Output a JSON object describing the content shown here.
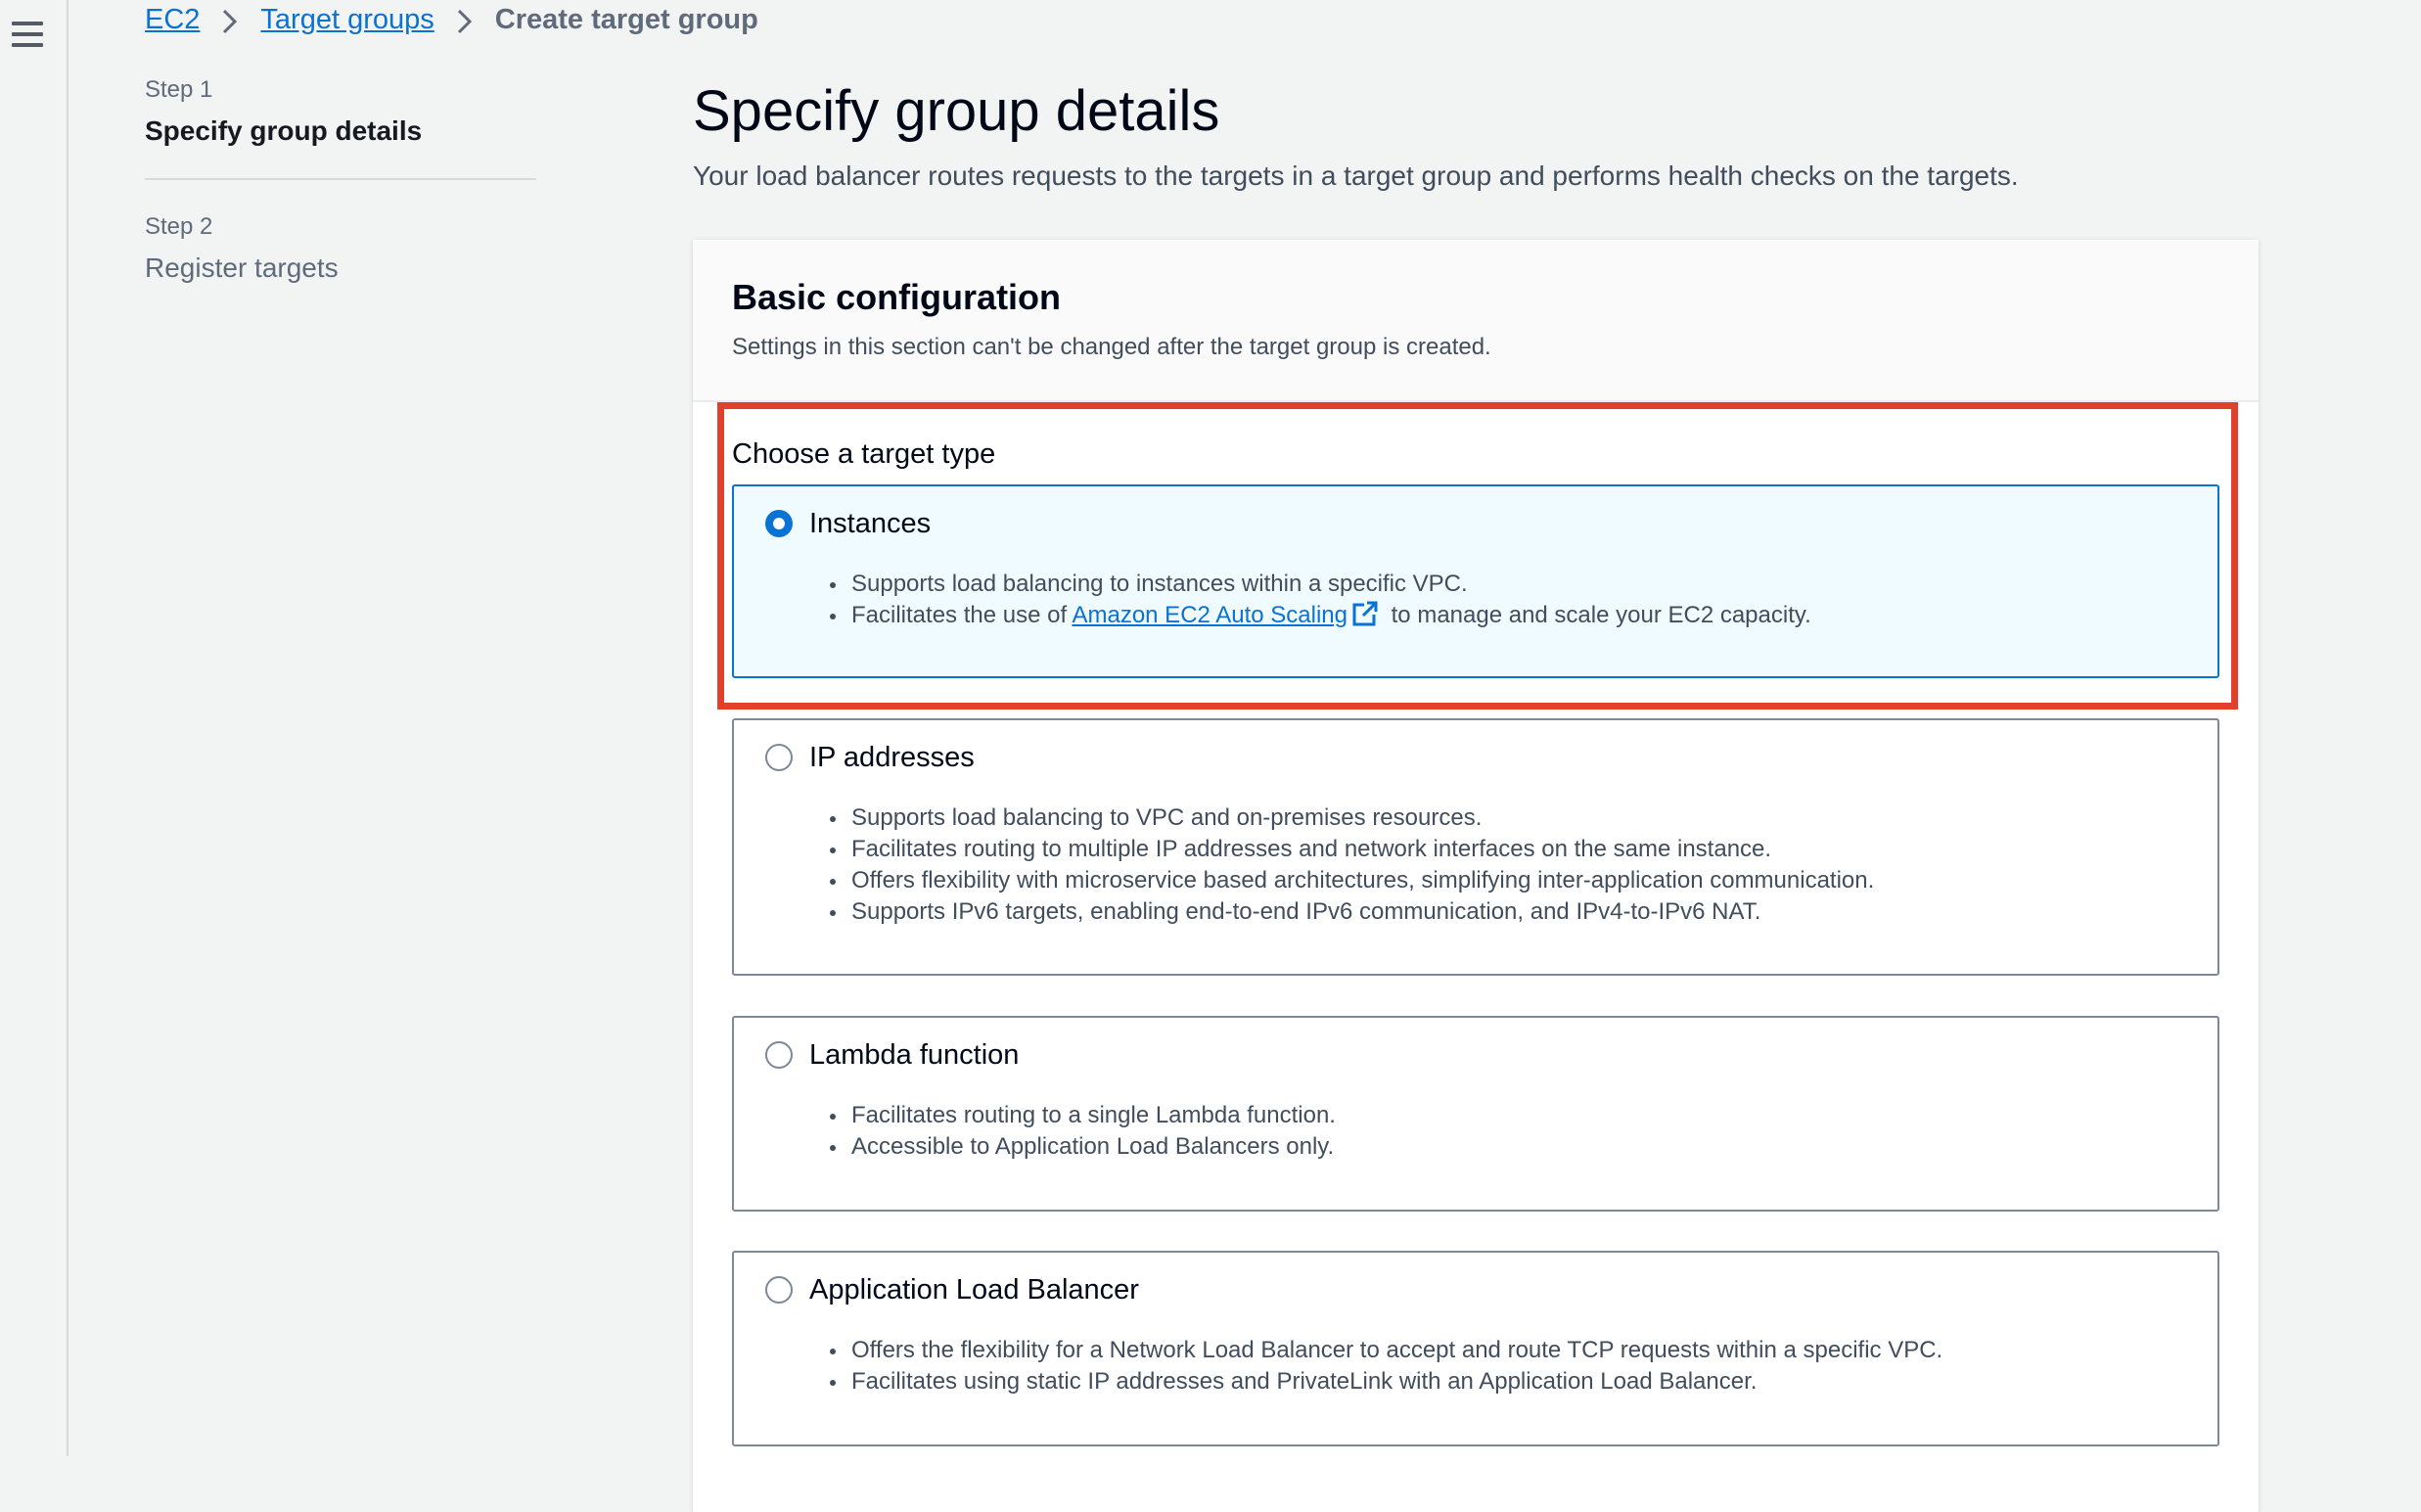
{
  "breadcrumb": {
    "items": [
      "EC2",
      "Target groups"
    ],
    "current": "Create target group"
  },
  "steps": [
    {
      "label": "Step 1",
      "title": "Specify group details"
    },
    {
      "label": "Step 2",
      "title": "Register targets"
    }
  ],
  "page": {
    "title": "Specify group details",
    "description": "Your load balancer routes requests to the targets in a target group and performs health checks on the targets."
  },
  "basic_config": {
    "title": "Basic configuration",
    "description": "Settings in this section can't be changed after the target group is created.",
    "target_type_label": "Choose a target type"
  },
  "target_types": [
    {
      "title": "Instances",
      "selected": true,
      "bullets": [
        "Supports load balancing to instances within a specific VPC."
      ],
      "bullet_link": {
        "prefix": "Facilitates the use of ",
        "link_text": "Amazon EC2 Auto Scaling",
        "suffix": " to manage and scale your EC2 capacity."
      }
    },
    {
      "title": "IP addresses",
      "selected": false,
      "bullets": [
        "Supports load balancing to VPC and on-premises resources.",
        "Facilitates routing to multiple IP addresses and network interfaces on the same instance.",
        "Offers flexibility with microservice based architectures, simplifying inter-application communication.",
        "Supports IPv6 targets, enabling end-to-end IPv6 communication, and IPv4-to-IPv6 NAT."
      ]
    },
    {
      "title": "Lambda function",
      "selected": false,
      "bullets": [
        "Facilitates routing to a single Lambda function.",
        "Accessible to Application Load Balancers only."
      ]
    },
    {
      "title": "Application Load Balancer",
      "selected": false,
      "bullets": [
        "Offers the flexibility for a Network Load Balancer to accept and route TCP requests within a specific VPC.",
        "Facilitates using static IP addresses and PrivateLink with an Application Load Balancer."
      ]
    }
  ],
  "colors": {
    "accent": "#0972d3",
    "highlight": "#e0412c",
    "selected_bg": "#f0fbff"
  }
}
